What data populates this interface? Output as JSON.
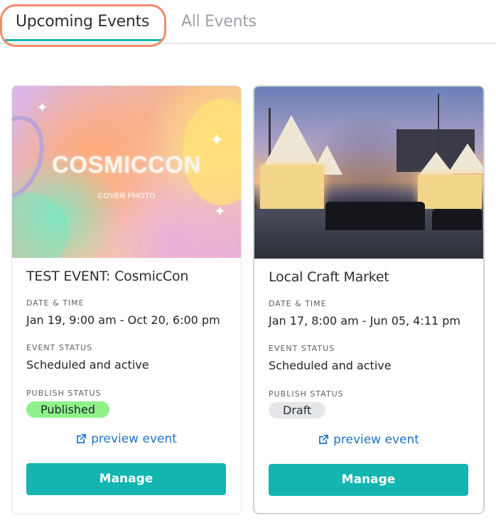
{
  "tabs": {
    "upcoming": "Upcoming Events",
    "all": "All Events"
  },
  "events": [
    {
      "title": "TEST EVENT: CosmicCon",
      "cover": {
        "title": "COSMICCON",
        "subtitle": "COVER PHOTO"
      },
      "date_label": "DATE & TIME",
      "date_value": "Jan 19, 9:00 am - Oct 20, 6:00 pm",
      "event_status_label": "EVENT STATUS",
      "event_status_value": "Scheduled and active",
      "publish_status_label": "PUBLISH STATUS",
      "publish_status_value": "Published",
      "preview_label": "preview event",
      "manage_label": "Manage"
    },
    {
      "title": "Local Craft Market",
      "date_label": "DATE & TIME",
      "date_value": "Jan 17, 8:00 am - Jun 05, 4:11 pm",
      "event_status_label": "EVENT STATUS",
      "event_status_value": "Scheduled and active",
      "publish_status_label": "PUBLISH STATUS",
      "publish_status_value": "Draft",
      "preview_label": "preview event",
      "manage_label": "Manage"
    }
  ],
  "colors": {
    "accent": "#12b5b0",
    "tab_highlight": "#f08c6b",
    "published_badge": "#8ef28b",
    "draft_badge": "#e4e6e8",
    "link": "#1f73c5"
  },
  "icons": {
    "preview": "external-link-icon"
  }
}
